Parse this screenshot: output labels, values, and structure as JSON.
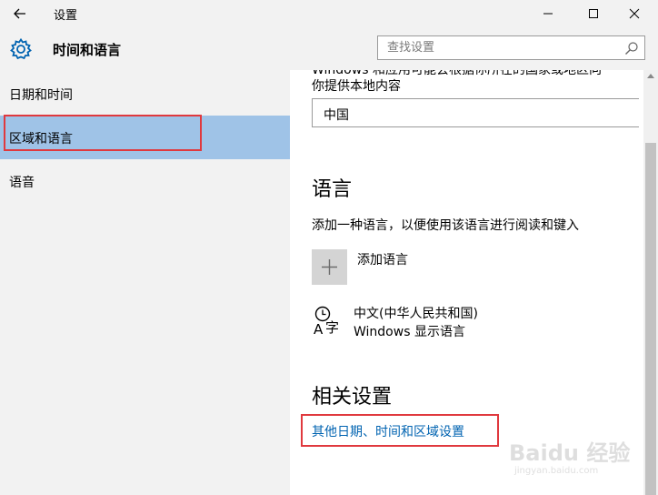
{
  "window": {
    "title": "设置"
  },
  "header": {
    "title": "时间和语言"
  },
  "search": {
    "placeholder": "查找设置"
  },
  "sidebar": {
    "items": [
      {
        "label": "日期和时间"
      },
      {
        "label": "区域和语言",
        "selected": true
      },
      {
        "label": "语音"
      }
    ]
  },
  "region": {
    "cut_text": "Windows 和应用可能会根据你所在的国家或地区向",
    "provide_text": "你提供本地内容",
    "selected": "中国"
  },
  "language": {
    "heading": "语言",
    "add_desc": "添加一种语言，以便使用该语言进行阅读和键入",
    "add_label": "添加语言",
    "current_name": "中文(中华人民共和国)",
    "current_sub": "Windows 显示语言"
  },
  "related": {
    "heading": "相关设置",
    "link": "其他日期、时间和区域设置"
  },
  "watermark": {
    "main": "Baidu 经验",
    "sub": "jingyan.baidu.com"
  },
  "colors": {
    "accent": "#0063b1",
    "selection": "#9fc3e7",
    "highlight_box": "#e0393e",
    "sidebar_bg": "#f2f2f2"
  },
  "icons": [
    "back-arrow-icon",
    "minimize-icon",
    "maximize-icon",
    "close-icon",
    "gear-icon",
    "search-icon",
    "plus-icon",
    "language-icon"
  ]
}
